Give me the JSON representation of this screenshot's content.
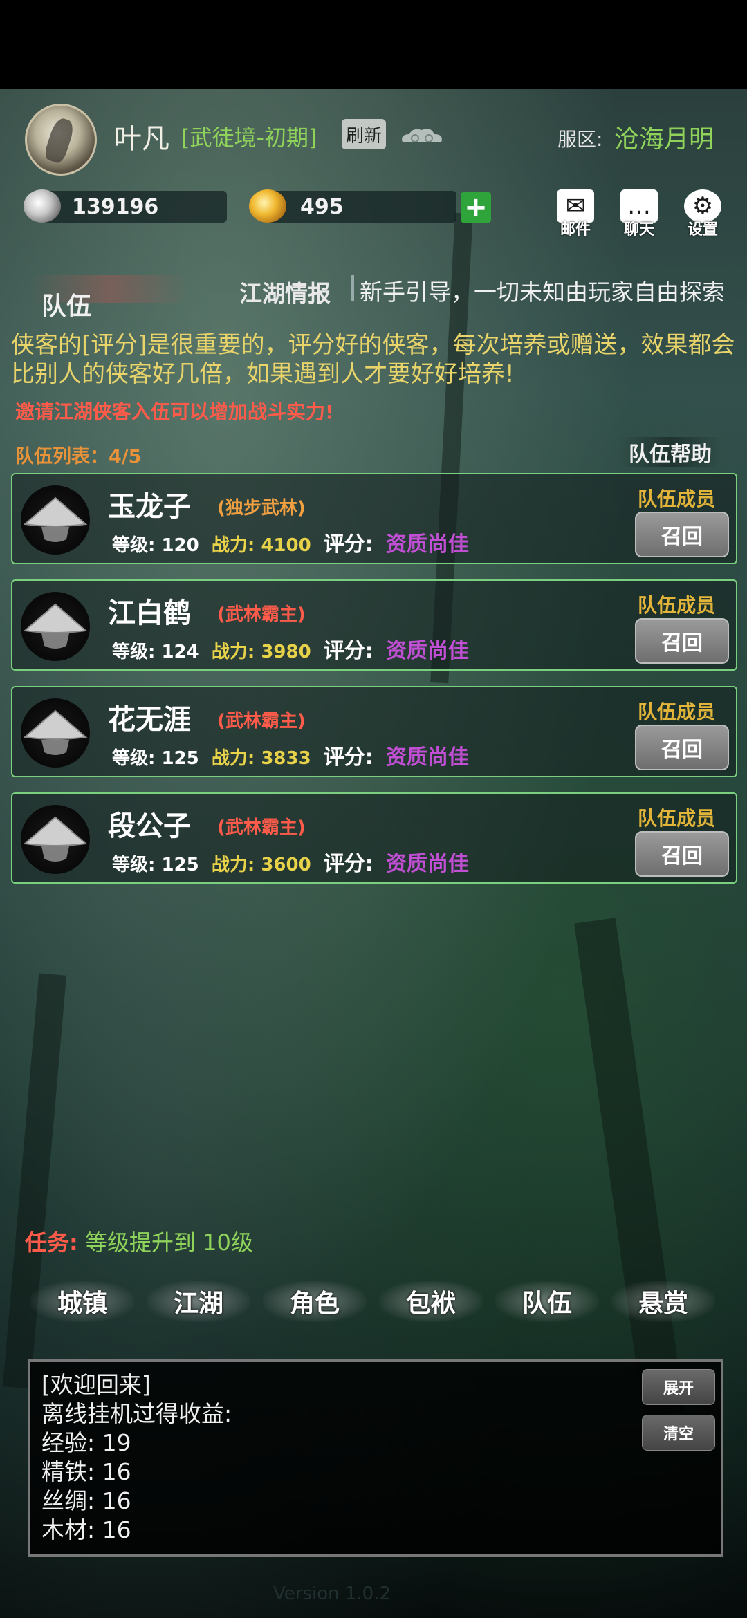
{
  "player": {
    "name": "叶凡",
    "realm": "[武徒境-初期]",
    "refresh_label": "刷新",
    "server_label": "服区:",
    "server_name": "沧海月明"
  },
  "resources": {
    "silver": "139196",
    "gold": "495"
  },
  "top_icons": {
    "mail": "邮件",
    "chat": "聊天",
    "settings": "设置"
  },
  "team": {
    "title": "队伍",
    "news_label": "江湖情报",
    "news_text": "新手引导，一切未知由玩家自由探索",
    "intro": "侠客的[评分]是很重要的，评分好的侠客，每次培养或赠送，效果都会比别人的侠客好几倍，如果遇到人才要好好培养!",
    "invite": "邀请江湖侠客入伍可以增加战斗实力!",
    "list_count": "队伍列表：4/5",
    "help_label": "队伍帮助"
  },
  "members": [
    {
      "name": "玉龙子",
      "tag": "(独步武林)",
      "tag_color": "#f0a040",
      "level_label": "等级:",
      "level": "120",
      "power_label": "战力:",
      "power": "4100",
      "score_label": "评分:",
      "score": "资质尚佳",
      "role": "队伍成员",
      "recall": "召回"
    },
    {
      "name": "江白鹤",
      "tag": "(武林霸主)",
      "tag_color": "#ff5b4a",
      "level_label": "等级:",
      "level": "124",
      "power_label": "战力:",
      "power": "3980",
      "score_label": "评分:",
      "score": "资质尚佳",
      "role": "队伍成员",
      "recall": "召回"
    },
    {
      "name": "花无涯",
      "tag": "(武林霸主)",
      "tag_color": "#ff5b4a",
      "level_label": "等级:",
      "level": "125",
      "power_label": "战力:",
      "power": "3833",
      "score_label": "评分:",
      "score": "资质尚佳",
      "role": "队伍成员",
      "recall": "召回"
    },
    {
      "name": "段公子",
      "tag": "(武林霸主)",
      "tag_color": "#ff5b4a",
      "level_label": "等级:",
      "level": "125",
      "power_label": "战力:",
      "power": "3600",
      "score_label": "评分:",
      "score": "资质尚佳",
      "role": "队伍成员",
      "recall": "召回"
    }
  ],
  "task": {
    "label": "任务:",
    "text": "等级提升到 10级"
  },
  "nav": [
    "城镇",
    "江湖",
    "角色",
    "包袱",
    "队伍",
    "悬赏"
  ],
  "log": {
    "lines": [
      "[欢迎回来]",
      "离线挂机过得收益:",
      "经验:  19",
      "精铁:  16",
      "丝绸:  16",
      "木材:  16"
    ],
    "expand_label": "展开",
    "clear_label": "清空"
  },
  "version": "Version 1.0.2"
}
